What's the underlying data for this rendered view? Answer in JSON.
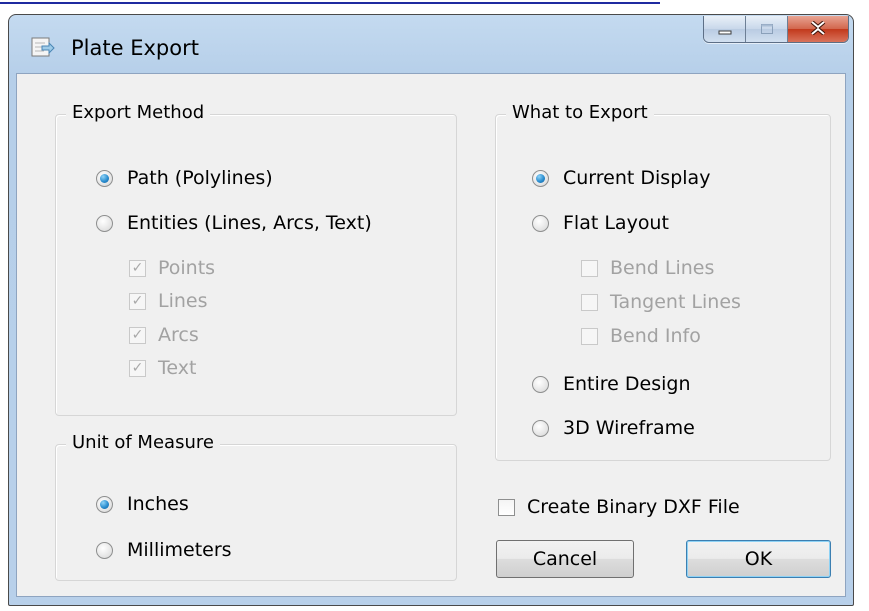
{
  "window": {
    "title": "Plate Export"
  },
  "export_method": {
    "label": "Export Method",
    "options": [
      {
        "label": "Path (Polylines)",
        "selected": true
      },
      {
        "label": "Entities (Lines, Arcs, Text)",
        "selected": false
      }
    ],
    "entity_checks": [
      {
        "label": "Points",
        "checked": true,
        "enabled": false
      },
      {
        "label": "Lines",
        "checked": true,
        "enabled": false
      },
      {
        "label": "Arcs",
        "checked": true,
        "enabled": false
      },
      {
        "label": "Text",
        "checked": true,
        "enabled": false
      }
    ]
  },
  "unit_of_measure": {
    "label": "Unit of Measure",
    "options": [
      {
        "label": "Inches",
        "selected": true
      },
      {
        "label": "Millimeters",
        "selected": false
      }
    ]
  },
  "what_to_export": {
    "label": "What to Export",
    "options": [
      {
        "label": "Current Display",
        "selected": true
      },
      {
        "label": "Flat Layout",
        "selected": false
      },
      {
        "label": "Entire Design",
        "selected": false
      },
      {
        "label": "3D Wireframe",
        "selected": false
      }
    ],
    "flat_layout_checks": [
      {
        "label": "Bend Lines",
        "checked": false,
        "enabled": false
      },
      {
        "label": "Tangent Lines",
        "checked": false,
        "enabled": false
      },
      {
        "label": "Bend Info",
        "checked": false,
        "enabled": false
      }
    ]
  },
  "binary_dxf": {
    "label": "Create Binary DXF File",
    "checked": false
  },
  "buttons": {
    "cancel": "Cancel",
    "ok": "OK"
  },
  "colors": {
    "accent": "#2b8ed0",
    "title_bar": "#b9d1ea",
    "close_button": "#c7462b"
  }
}
